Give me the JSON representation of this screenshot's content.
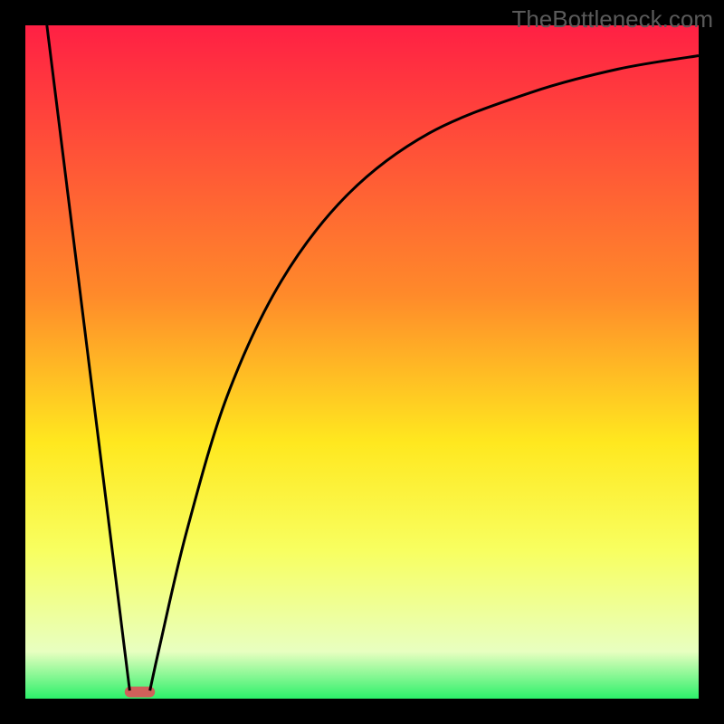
{
  "watermark": "TheBottleneck.com",
  "chart_data": {
    "type": "line",
    "title": "",
    "xlabel": "",
    "ylabel": "",
    "xlim": [
      0,
      100
    ],
    "ylim": [
      0,
      100
    ],
    "gradient": {
      "stops": [
        {
          "offset": 0,
          "color": "#ff2044"
        },
        {
          "offset": 40,
          "color": "#ff8a2a"
        },
        {
          "offset": 62,
          "color": "#ffe81f"
        },
        {
          "offset": 78,
          "color": "#f8ff60"
        },
        {
          "offset": 93,
          "color": "#e8ffc0"
        },
        {
          "offset": 100,
          "color": "#2cf06a"
        }
      ]
    },
    "series": [
      {
        "name": "left-line",
        "type": "linear",
        "points": [
          {
            "x": 3.2,
            "y": 100
          },
          {
            "x": 15.5,
            "y": 1.2
          }
        ]
      },
      {
        "name": "right-curve",
        "type": "curve",
        "points": [
          {
            "x": 18.5,
            "y": 1.2
          },
          {
            "x": 20,
            "y": 8
          },
          {
            "x": 24,
            "y": 25
          },
          {
            "x": 30,
            "y": 45
          },
          {
            "x": 38,
            "y": 62
          },
          {
            "x": 48,
            "y": 75
          },
          {
            "x": 60,
            "y": 84
          },
          {
            "x": 75,
            "y": 90
          },
          {
            "x": 88,
            "y": 93.5
          },
          {
            "x": 100,
            "y": 95.5
          }
        ]
      }
    ],
    "marker": {
      "x": 17,
      "y": 1.0,
      "width": 4.5,
      "height": 1.6,
      "color": "#d0605a"
    },
    "frame": {
      "color": "#000000",
      "thickness_outer": 28,
      "thickness_inner": 26
    }
  }
}
